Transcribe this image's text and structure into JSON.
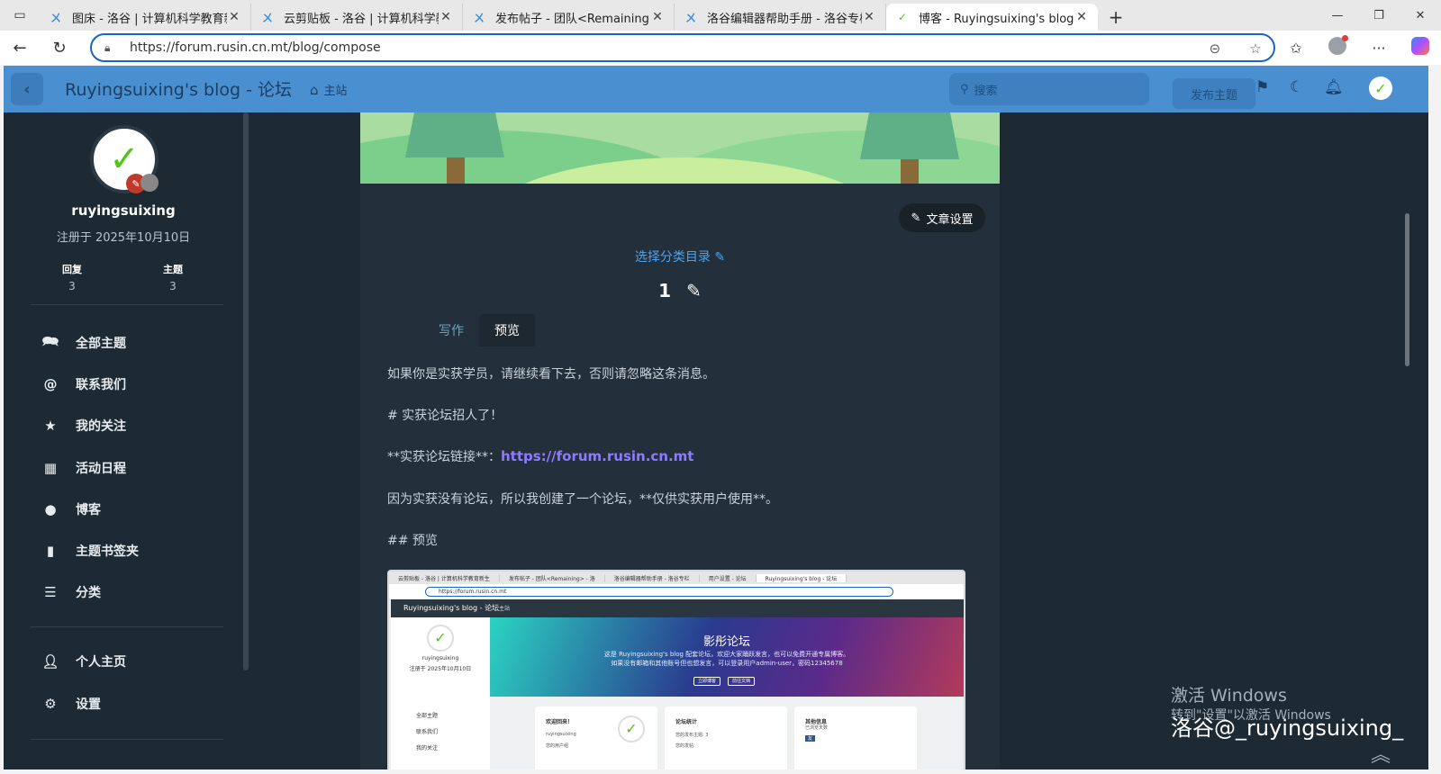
{
  "browser": {
    "tabs": [
      {
        "title": "图床 - 洛谷 | 计算机科学教育新生",
        "active": false
      },
      {
        "title": "云剪贴板 - 洛谷 | 计算机科学教育",
        "active": false
      },
      {
        "title": "发布帖子 - 团队<Remaining> - 洛",
        "active": false
      },
      {
        "title": "洛谷编辑器帮助手册 - 洛谷专栏",
        "active": false
      },
      {
        "title": "博客 - Ruyingsuixing's blog - 论坛",
        "active": true
      }
    ],
    "url": "https://forum.rusin.cn.mt/blog/compose"
  },
  "topbar": {
    "site_title": "Ruyingsuixing's blog - 论坛",
    "home_label": "主站",
    "search_placeholder": "搜索",
    "post_button": "发布主题"
  },
  "sidebar": {
    "username": "ruyingsuixing",
    "joined": "注册于 2025年10月10日",
    "stats": [
      {
        "label": "回复",
        "value": "3"
      },
      {
        "label": "主题",
        "value": "3"
      }
    ],
    "menu": [
      {
        "label": "全部主题",
        "icon": "comments-icon"
      },
      {
        "label": "联系我们",
        "icon": "at-icon"
      },
      {
        "label": "我的关注",
        "icon": "star-icon"
      },
      {
        "label": "活动日程",
        "icon": "calendar-icon"
      },
      {
        "label": "博客",
        "icon": "comment-icon"
      },
      {
        "label": "主题书签夹",
        "icon": "bookmark-icon"
      },
      {
        "label": "分类",
        "icon": "list-icon"
      }
    ],
    "menu2": [
      {
        "label": "个人主页",
        "icon": "user-icon"
      },
      {
        "label": "设置",
        "icon": "gear-icon"
      }
    ]
  },
  "composer": {
    "settings_button": "文章设置",
    "category_link": "选择分类目录",
    "title": "1",
    "tabs": [
      {
        "label": "写作",
        "active": false
      },
      {
        "label": "预览",
        "active": true
      }
    ],
    "paragraphs": [
      "如果你是实获学员，请继续看下去，否则请忽略这条消息。",
      "# 实获论坛招人了！",
      "因为实获没有论坛，所以我创建了一个论坛，**仅供实获用户使用**。",
      "## 预览"
    ],
    "link_prefix": "**实获论坛链接**：",
    "link_url": "https://forum.rusin.cn.mt"
  },
  "embedded_screenshot": {
    "tabs": [
      "云剪贴板 - 洛谷 | 计算机科学教育新生",
      "发布帖子 - 团队<Remaining> - 洛",
      "洛谷编辑器帮助手册 - 洛谷专栏",
      "用户设置 - 论坛",
      "Ruyingsuixing's blog - 论坛"
    ],
    "url": "https://forum.rusin.cn.mt",
    "site_title": "Ruyingsuixing's blog - 论坛",
    "home": "主站",
    "username": "ruyingsuixing",
    "joined": "注册于 2025年10月10日",
    "menu": [
      "全部主题",
      "联系我们",
      "我的关注"
    ],
    "hero_title": "影彤论坛",
    "hero_line1": "这是 Ruyingsuixing's blog 配套论坛，欢迎大家踊跃发言，也可以免费开通专属博客。",
    "hero_line2": "如果没有邮箱和其他账号但也想发言，可以登录用户admin-user，密码12345678",
    "hero_btn1": "立即博客",
    "hero_btn2": "前往文档",
    "card1_title": "欢迎回来！",
    "card1_sub1": "ruyingsuixing",
    "card1_sub2": "您的用户组",
    "card2_title": "论坛统计",
    "card2_sub1": "您的发布主题: 3",
    "card2_sub2": "您的发帖:",
    "card3_title": "其他信息",
    "card3_sub1": "已浏览天数",
    "card3_sub2": "友"
  },
  "watermark": {
    "line1": "激活 Windows",
    "line2": "转到\"设置\"以激活 Windows",
    "overlay": "洛谷@_ruyingsuixing_"
  },
  "colors": {
    "topbar": "#4a8fd0",
    "app_bg": "#1d2a33",
    "panel_bg": "#232f3a",
    "link": "#4da3f0",
    "link_purple": "#8f7bff"
  }
}
